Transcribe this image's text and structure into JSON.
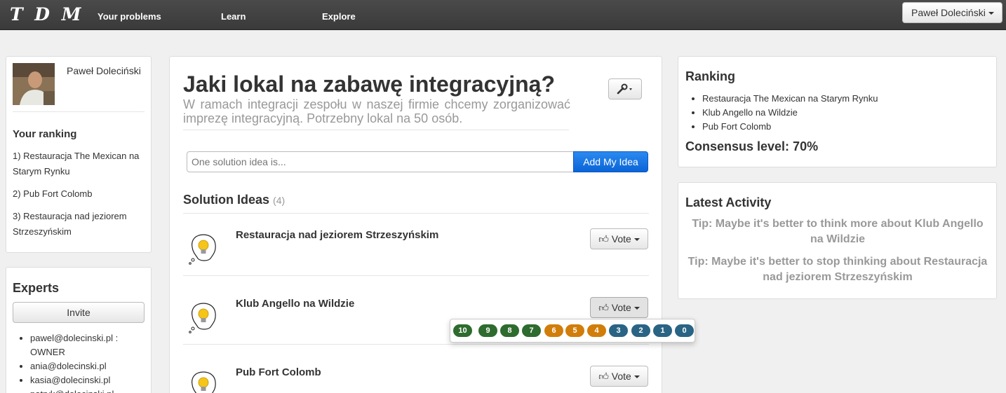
{
  "navbar": {
    "brand": "T D M",
    "links": [
      "Your problems",
      "Learn",
      "Explore"
    ],
    "user": "Paweł Doleciński"
  },
  "profile": {
    "name": "Paweł Doleciński",
    "ranking_title": "Your ranking",
    "ranking": [
      "1) Restauracja The Mexican na Starym Rynku",
      "2) Pub Fort Colomb",
      "3) Restauracja nad jeziorem Strzeszyńskim"
    ]
  },
  "experts": {
    "title": "Experts",
    "invite_label": "Invite",
    "list": [
      "pawel@dolecinski.pl : OWNER",
      "ania@dolecinski.pl",
      "kasia@dolecinski.pl",
      "patryk@dolecinski.pl"
    ]
  },
  "problem": {
    "title": "Jaki lokal na zabawę integracyjną?",
    "description": "W ramach integracji zespołu w naszej firmie chcemy zorganizować imprezę integracyjną. Potrzebny lokal na 50 osób.",
    "input_placeholder": "One solution idea is...",
    "add_label": "Add My Idea",
    "solutions_title": "Solution Ideas",
    "solutions_count": "(4)",
    "vote_label": "Vote",
    "ideas": [
      "Restauracja nad jeziorem Strzeszyńskim",
      "Klub Angello na Wildzie",
      "Pub Fort Colomb"
    ],
    "scores": [
      {
        "label": "10",
        "color": "#2e6b2e"
      },
      {
        "label": "9",
        "color": "#2e6b2e"
      },
      {
        "label": "8",
        "color": "#2e6b2e"
      },
      {
        "label": "7",
        "color": "#2e6b2e"
      },
      {
        "label": "6",
        "color": "#d17d0a"
      },
      {
        "label": "5",
        "color": "#d17d0a"
      },
      {
        "label": "4",
        "color": "#d17d0a"
      },
      {
        "label": "3",
        "color": "#2a6484"
      },
      {
        "label": "2",
        "color": "#2a6484"
      },
      {
        "label": "1",
        "color": "#2a6484"
      },
      {
        "label": "0",
        "color": "#2a6484"
      }
    ]
  },
  "ranking_panel": {
    "title": "Ranking",
    "items": [
      "Restauracja The Mexican na Starym Rynku",
      "Klub Angello na Wildzie",
      "Pub Fort Colomb"
    ],
    "consensus": "Consensus level: 70%"
  },
  "activity": {
    "title": "Latest Activity",
    "tips": [
      "Tip: Maybe it's better to think more about Klub Angello na Wildzie",
      "Tip: Maybe it's better to stop thinking about Restauracja nad jeziorem Strzeszyńskim"
    ]
  }
}
